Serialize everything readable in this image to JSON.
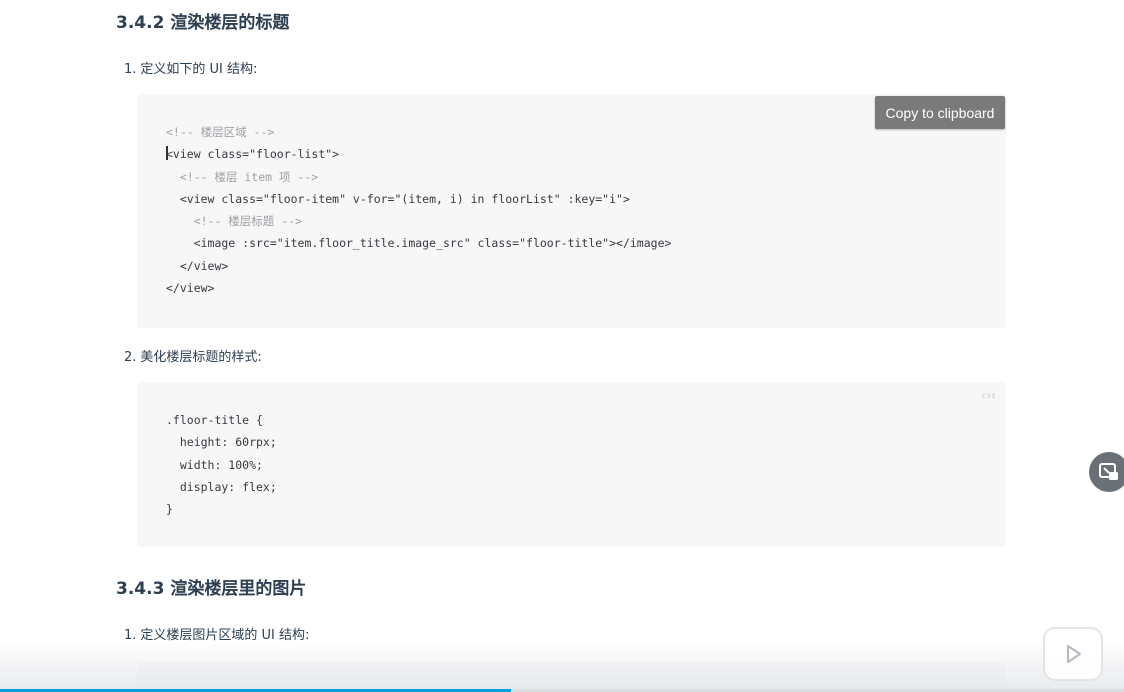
{
  "headings": {
    "s342": "3.4.2 渲染楼层的标题",
    "s343": "3.4.3 渲染楼层里的图片"
  },
  "steps": {
    "s342_1": {
      "num": "1.",
      "text": "定义如下的 UI 结构:"
    },
    "s342_2": {
      "num": "2.",
      "text": "美化楼层标题的样式:"
    },
    "s343_1": {
      "num": "1.",
      "text": "定义楼层图片区域的 UI 结构:"
    }
  },
  "code_block_1": {
    "copy_label": "Copy to clipboard",
    "lines": [
      "<!-- 楼层区域 -->",
      "<view class=\"floor-list\">",
      "  <!-- 楼层 item 项 -->",
      "  <view class=\"floor-item\" v-for=\"(item, i) in floorList\" :key=\"i\">",
      "    <!-- 楼层标题 -->",
      "    <image :src=\"item.floor_title.image_src\" class=\"floor-title\"></image>",
      "  </view>",
      "</view>"
    ]
  },
  "code_block_2": {
    "lang": "css",
    "lines": [
      ".floor-title {",
      "  height: 60rpx;",
      "  width: 100%;",
      "  display: flex;",
      "}"
    ]
  },
  "player": {
    "progress": 0.455,
    "accent": "#00a1d6",
    "pip_icon": "pip-icon",
    "play_icon": "play-icon"
  }
}
